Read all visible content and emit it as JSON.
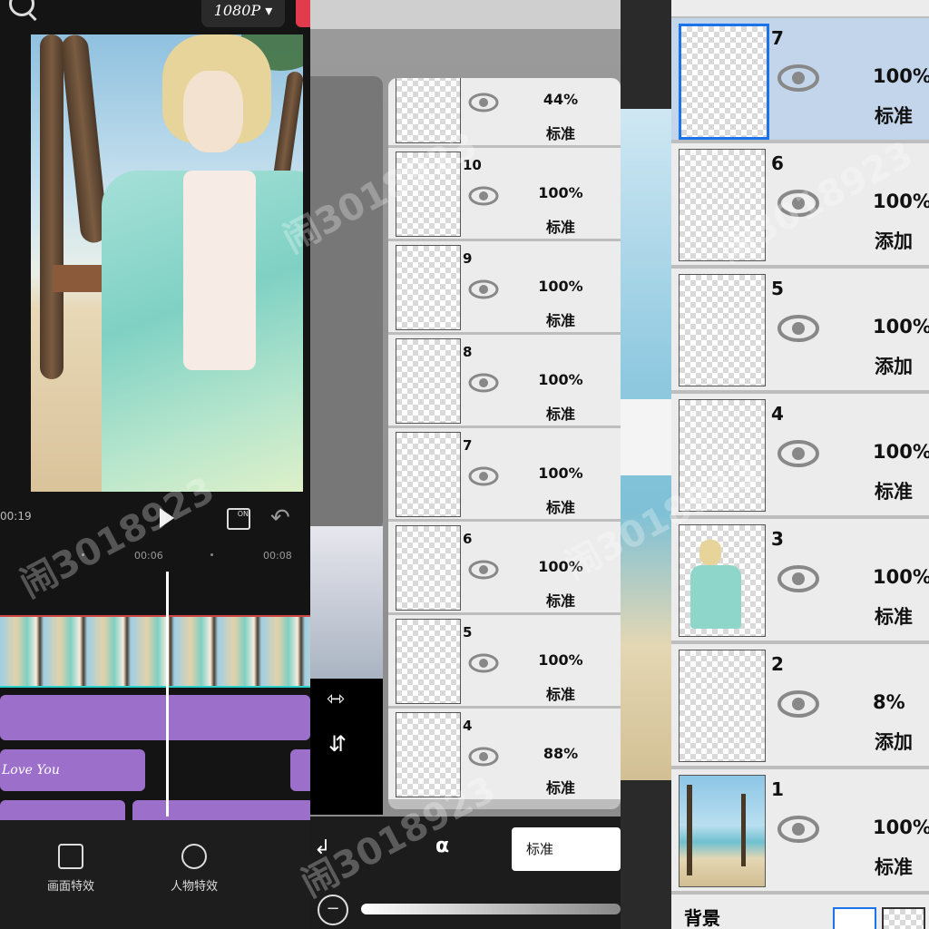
{
  "editor": {
    "resolution": "1080P",
    "time_current": "00:19",
    "ticks": [
      "00:06",
      "00:08"
    ],
    "clip1_text": "Love You",
    "tools": [
      {
        "label": "画面特效",
        "icon": "image-effect-icon"
      },
      {
        "label": "人物特效",
        "icon": "face-effect-icon"
      }
    ]
  },
  "layers_small": [
    {
      "num": "",
      "opacity": "44%",
      "mode": "标准"
    },
    {
      "num": "10",
      "opacity": "100%",
      "mode": "标准"
    },
    {
      "num": "9",
      "opacity": "100%",
      "mode": "标准"
    },
    {
      "num": "8",
      "opacity": "100%",
      "mode": "标准"
    },
    {
      "num": "7",
      "opacity": "100%",
      "mode": "标准"
    },
    {
      "num": "6",
      "opacity": "100%",
      "mode": "标准"
    },
    {
      "num": "5",
      "opacity": "100%",
      "mode": "标准"
    },
    {
      "num": "4",
      "opacity": "88%",
      "mode": "标准"
    }
  ],
  "blend_mode_selected": "标准",
  "alpha_lock_label": "α",
  "layers_large": [
    {
      "num": "7",
      "opacity": "100%",
      "mode": "标准",
      "selected": true
    },
    {
      "num": "6",
      "opacity": "100%",
      "mode": "添加"
    },
    {
      "num": "5",
      "opacity": "100%",
      "mode": "添加"
    },
    {
      "num": "4",
      "opacity": "100%",
      "mode": "标准"
    },
    {
      "num": "3",
      "opacity": "100%",
      "mode": "标准"
    },
    {
      "num": "2",
      "opacity": "8%",
      "mode": "添加"
    },
    {
      "num": "1",
      "opacity": "100%",
      "mode": "标准"
    }
  ],
  "background_label": "背景",
  "watermark": "闹3018923",
  "colors": {
    "accent_purple": "#9c6fcb",
    "selection_blue": "#1a73e8",
    "record_red": "#e23b4b"
  }
}
